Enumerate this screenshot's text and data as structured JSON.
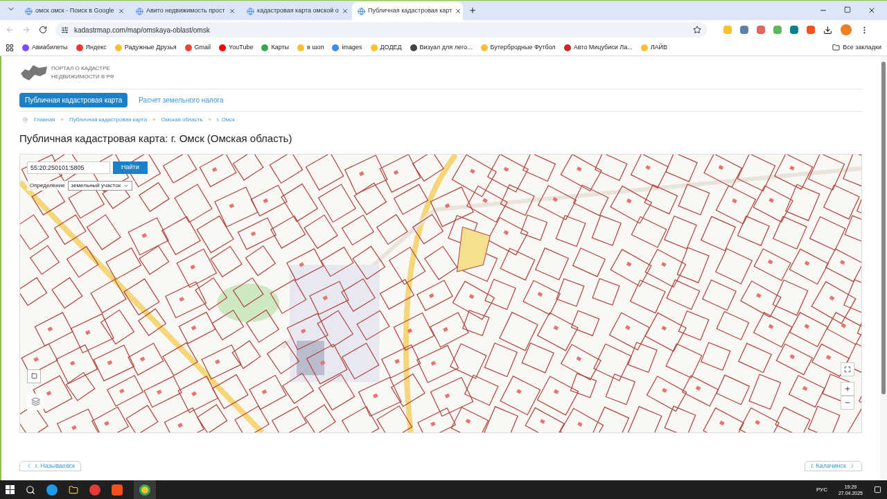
{
  "tabs": [
    {
      "title": "омск омск - Поиск в Google",
      "selected": false
    },
    {
      "title": "Авито недвижимость прост",
      "selected": false
    },
    {
      "title": "кадастровая карта омской о",
      "selected": false
    },
    {
      "title": "Публичная кадастровая карт",
      "selected": true
    }
  ],
  "address": {
    "url": "kadastrmap.com/map/omskaya-oblast/omsk"
  },
  "bookmarks": [
    {
      "label": "Авиабилеты"
    },
    {
      "label": "Яндекс"
    },
    {
      "label": "Радужные Друзья"
    },
    {
      "label": "Gmail"
    },
    {
      "label": "YouTube"
    },
    {
      "label": "Карты"
    },
    {
      "label": "в шоп"
    },
    {
      "label": "images"
    },
    {
      "label": "ДОДЕД"
    },
    {
      "label": "Визуал для лего..."
    },
    {
      "label": "Бутербродные Футбол"
    },
    {
      "label": "Авто Мицубиси Ла..."
    },
    {
      "label": "ЛАЙВ"
    }
  ],
  "all_bookmarks": "Все закладки",
  "site": {
    "logo_lines": [
      "ПОРТАЛ О КАДАСТРЕ",
      "НЕДВИЖИМОСТИ В РФ"
    ],
    "nav": [
      {
        "label": "Публичная кадастровая карта",
        "selected": true
      },
      {
        "label": "Расчет земельного налога",
        "selected": false
      }
    ],
    "breadcrumbs": [
      "Главная",
      "Публичная кадастровая карта",
      "Омская область",
      "г. Омск"
    ],
    "breadcrumb_separator": "»",
    "title": "Публичная кадастровая карта: г. Омск (Омская область)"
  },
  "map": {
    "search_value": "55:20:250101:5805",
    "search_button": "Найти",
    "select_label": "Определение",
    "select_value": "земельный участок"
  },
  "pager": {
    "prev": "г. Называевск",
    "next": "г. Калачинск"
  },
  "taskbar": {
    "lang": "РУС",
    "time": "19:29",
    "date": "27.04.2025"
  }
}
